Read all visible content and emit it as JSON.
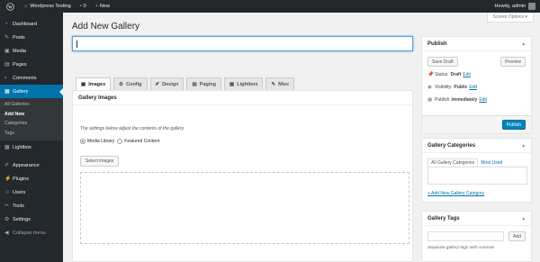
{
  "adminbar": {
    "site_name": "Wordpress Testing",
    "comments_count": "0",
    "new_label": "New",
    "howdy": "Howdy, admin"
  },
  "sidemenu": {
    "items": [
      {
        "icon": "dashboard-icon",
        "label": "Dashboard"
      },
      {
        "icon": "pin-icon",
        "label": "Posts"
      },
      {
        "icon": "media-icon",
        "label": "Media"
      },
      {
        "icon": "pages-icon",
        "label": "Pages"
      },
      {
        "icon": "comments-icon",
        "label": "Comments"
      },
      {
        "icon": "gallery-icon",
        "label": "Gallery"
      },
      {
        "icon": "lightbox-icon",
        "label": "Lightbox"
      },
      {
        "icon": "appearance-icon",
        "label": "Appearance"
      },
      {
        "icon": "plugins-icon",
        "label": "Plugins"
      },
      {
        "icon": "users-icon",
        "label": "Users"
      },
      {
        "icon": "tools-icon",
        "label": "Tools"
      },
      {
        "icon": "settings-icon",
        "label": "Settings"
      },
      {
        "icon": "collapse-icon",
        "label": "Collapse menu"
      }
    ],
    "submenu": [
      "All Galleries",
      "Add New",
      "Categories",
      "Tags"
    ]
  },
  "screen_options": "Screen Options ▾",
  "page_title": "Add New Gallery",
  "title_input": {
    "value": "",
    "placeholder": ""
  },
  "tabs": [
    {
      "icon": "images-icon",
      "label": "Images"
    },
    {
      "icon": "gear-icon",
      "label": "Config"
    },
    {
      "icon": "brush-icon",
      "label": "Design"
    },
    {
      "icon": "paging-icon",
      "label": "Paging"
    },
    {
      "icon": "lightbox-icon",
      "label": "Lightbox"
    },
    {
      "icon": "misc-icon",
      "label": "Misc"
    }
  ],
  "gallery_images": {
    "heading": "Gallery Images",
    "description": "The settings below adjust the contents of the gallery.",
    "source_options": [
      "Media Library",
      "Featured Content"
    ],
    "selected_source": "Media Library",
    "select_button": "Select images"
  },
  "publish": {
    "heading": "Publish",
    "save_draft": "Save Draft",
    "preview": "Preview",
    "status_label": "Status:",
    "status_value": "Draft",
    "visibility_label": "Visibility:",
    "visibility_value": "Public",
    "schedule_label": "Publish",
    "schedule_value": "immediately",
    "edit_link": "Edit",
    "publish_button": "Publish"
  },
  "gallery_categories": {
    "heading": "Gallery Categories",
    "tab_all": "All Gallery Categories",
    "tab_most_used": "Most Used",
    "add_new": "+ Add New Gallery Category"
  },
  "gallery_tags": {
    "heading": "Gallery Tags",
    "add_button": "Add",
    "hint": "Separate gallery tags with commas"
  },
  "colors": {
    "accent": "#0073aa",
    "primary_button": "#0085ba",
    "sidebar_bg": "#23282d"
  }
}
